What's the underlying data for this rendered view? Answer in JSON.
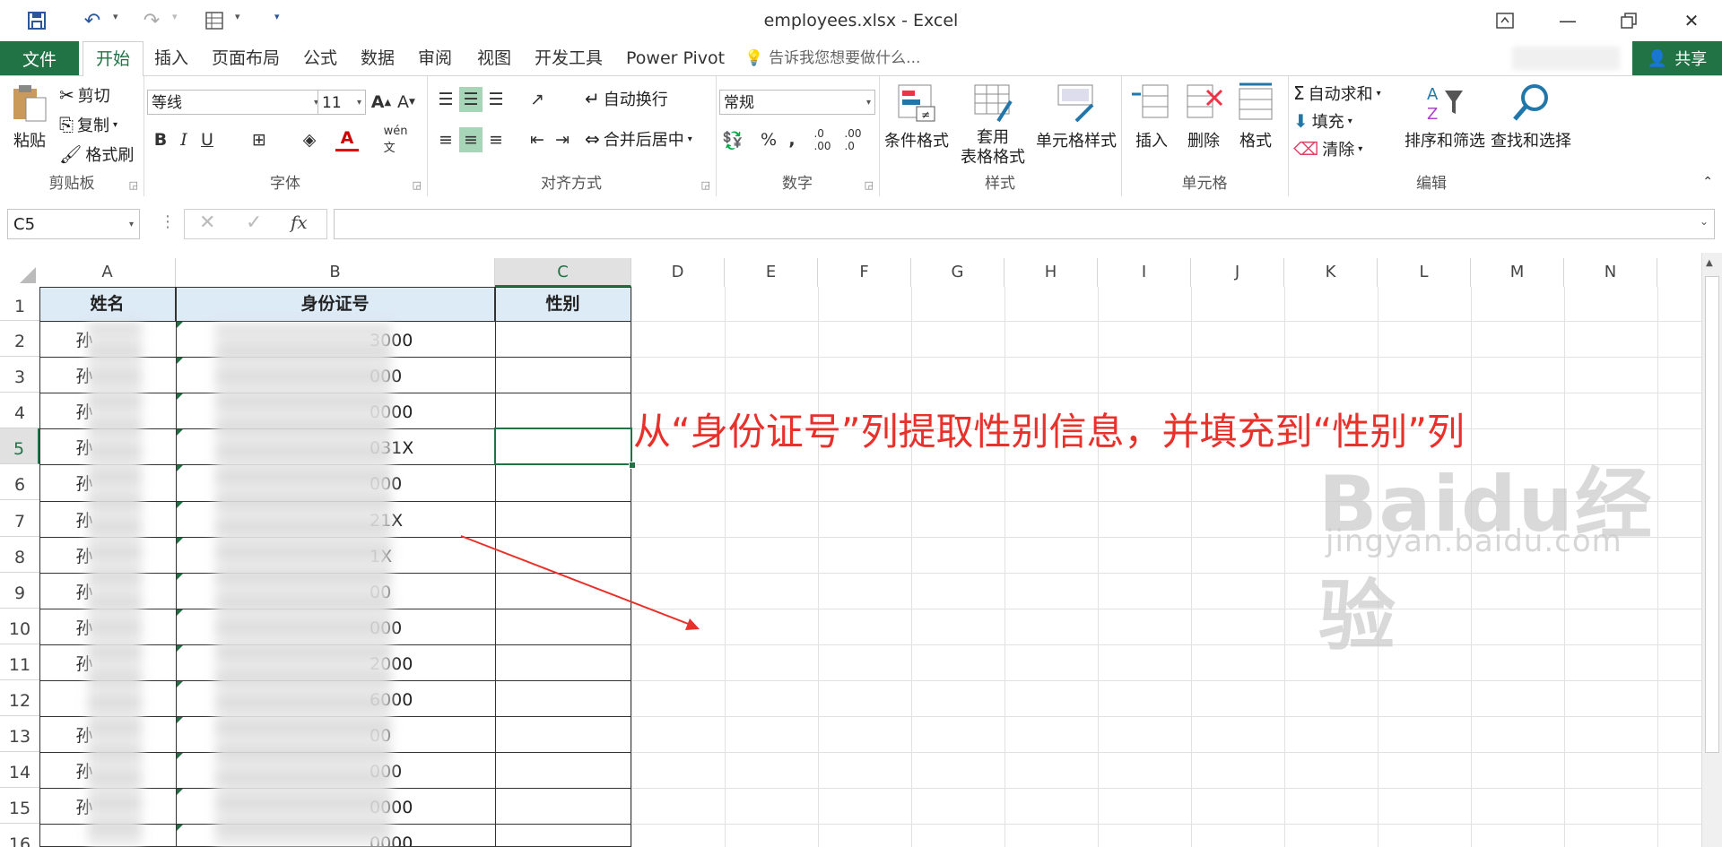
{
  "window": {
    "title": "employees.xlsx - Excel"
  },
  "tabs": [
    {
      "label": "文件"
    },
    {
      "label": "开始"
    },
    {
      "label": "插入"
    },
    {
      "label": "页面布局"
    },
    {
      "label": "公式"
    },
    {
      "label": "数据"
    },
    {
      "label": "审阅"
    },
    {
      "label": "视图"
    },
    {
      "label": "开发工具"
    },
    {
      "label": "Power Pivot"
    }
  ],
  "tellme": "告诉我您想要做什么...",
  "share": "共享",
  "ribbon": {
    "clipboard": {
      "label": "剪贴板",
      "paste": "粘贴",
      "cut": "剪切",
      "copy": "复制",
      "format_painter": "格式刷"
    },
    "font": {
      "label": "字体",
      "name": "等线",
      "size": "11"
    },
    "alignment": {
      "label": "对齐方式",
      "wrap": "自动换行",
      "merge": "合并后居中"
    },
    "number": {
      "label": "数字",
      "format": "常规"
    },
    "styles": {
      "label": "样式",
      "conditional": "条件格式",
      "table_format_1": "套用",
      "table_format_2": "表格格式",
      "cell_styles": "单元格样式"
    },
    "cells": {
      "label": "单元格",
      "insert": "插入",
      "delete": "删除",
      "format": "格式"
    },
    "editing": {
      "label": "编辑",
      "autosum": "自动求和",
      "fill": "填充",
      "clear": "清除",
      "sort": "排序和筛选",
      "find": "查找和选择"
    }
  },
  "formula_bar": {
    "name_box": "C5",
    "fx": "fx",
    "value": ""
  },
  "sheet": {
    "columns": [
      "A",
      "B",
      "C",
      "D",
      "E",
      "F",
      "G",
      "H",
      "I",
      "J",
      "K",
      "L",
      "M",
      "N"
    ],
    "selected_column": "C",
    "rows": [
      "1",
      "2",
      "3",
      "4",
      "5",
      "6",
      "7",
      "8",
      "9",
      "10",
      "11",
      "12",
      "13",
      "14",
      "15",
      "16"
    ],
    "selected_row": "5",
    "headers": {
      "a": "姓名",
      "b": "身份证号",
      "c": "性别"
    },
    "data": [
      {
        "a": "孙",
        "b": "3000"
      },
      {
        "a": "孙",
        "b": "000"
      },
      {
        "a": "孙",
        "b": "0000"
      },
      {
        "a": "孙",
        "b": "031X"
      },
      {
        "a": "孙",
        "b": "000"
      },
      {
        "a": "孙",
        "b": "21X"
      },
      {
        "a": "孙",
        "b": "1X"
      },
      {
        "a": "孙",
        "b": "00"
      },
      {
        "a": "孙",
        "b": "000"
      },
      {
        "a": "孙",
        "b": "2000"
      },
      {
        "a": "",
        "b": "6000"
      },
      {
        "a": "孙",
        "b": "00"
      },
      {
        "a": "孙",
        "b": "000"
      },
      {
        "a": "孙",
        "b": "0000"
      },
      {
        "a": "",
        "b": "0000"
      }
    ]
  },
  "annotation": "从“身份证号”列提取性别信息，并填充到“性别”列",
  "watermark": {
    "main": "Baidu经验",
    "sub": "jingyan.baidu.com"
  },
  "colors": {
    "excel_green": "#217346",
    "annotation_red": "#e8312b"
  }
}
